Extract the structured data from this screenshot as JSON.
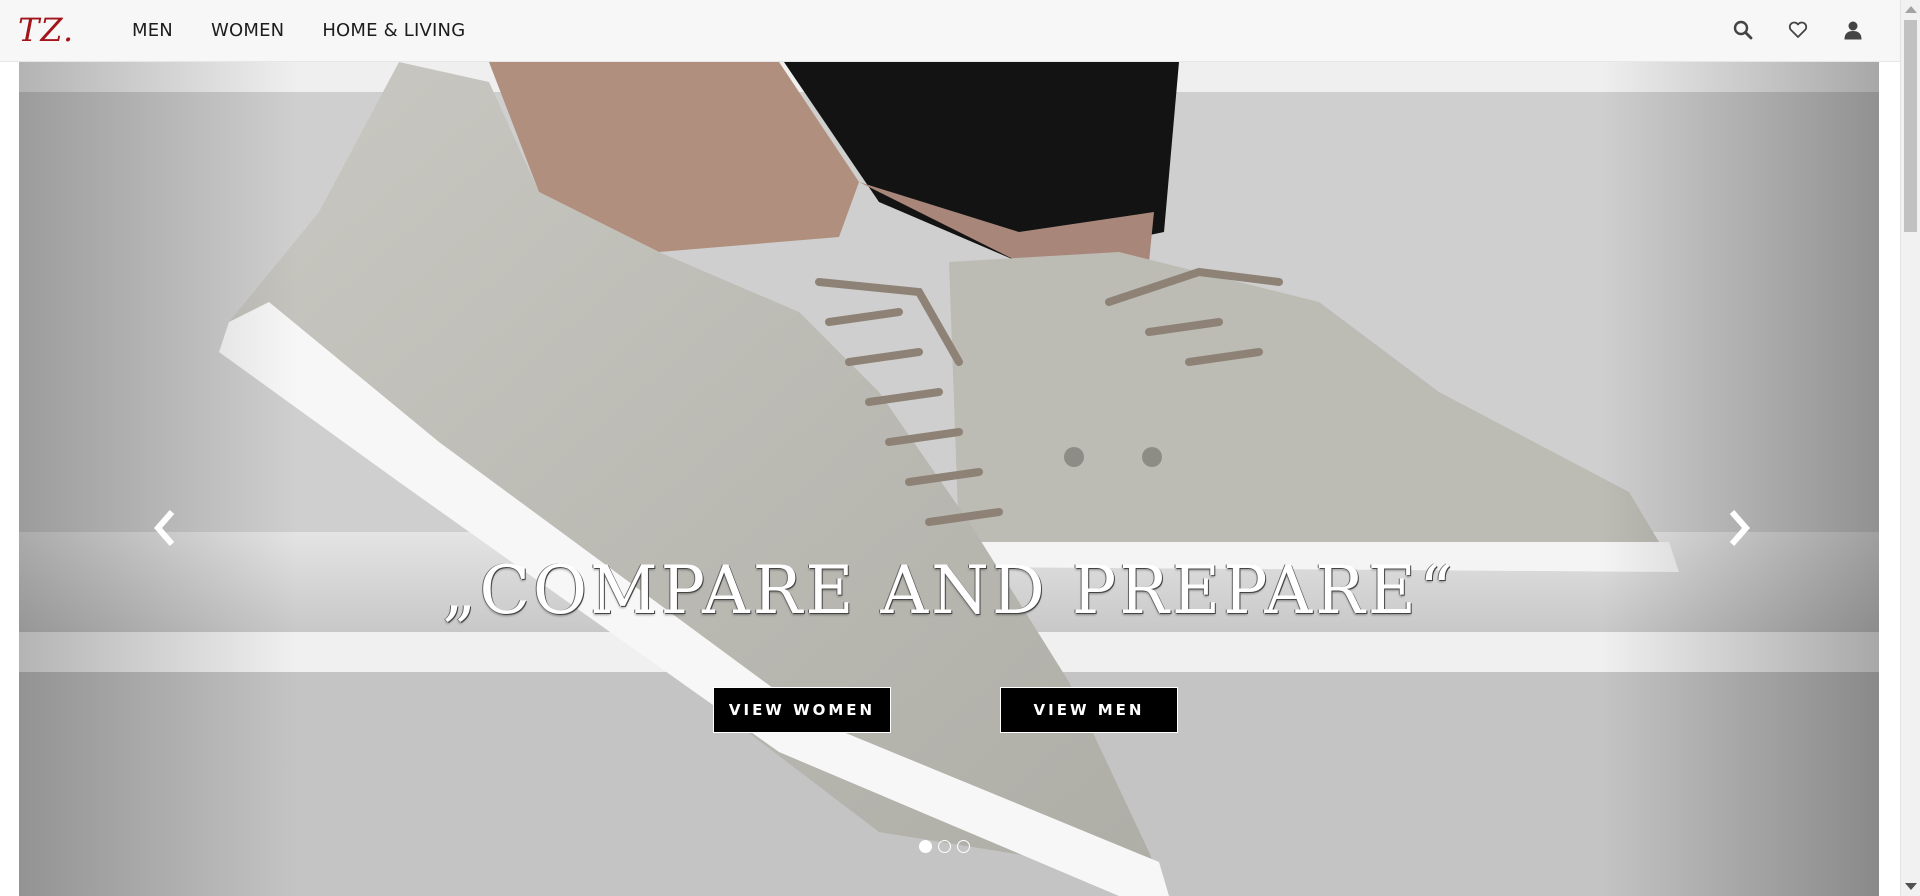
{
  "header": {
    "logo": "TZ.",
    "nav": [
      {
        "label": "MEN"
      },
      {
        "label": "WOMEN"
      },
      {
        "label": "HOME & LIVING"
      }
    ],
    "icons": [
      "search-icon",
      "heart-icon",
      "user-icon"
    ],
    "logo_color": "#a3141a"
  },
  "hero": {
    "headline": "„COMPARE AND PREPARE“",
    "buttons": {
      "women_label": "VIEW WOMEN",
      "men_label": "VIEW MEN"
    },
    "slides_total": 3,
    "active_slide": 1,
    "prev_icon": "chevron-left-icon",
    "next_icon": "chevron-right-icon"
  }
}
